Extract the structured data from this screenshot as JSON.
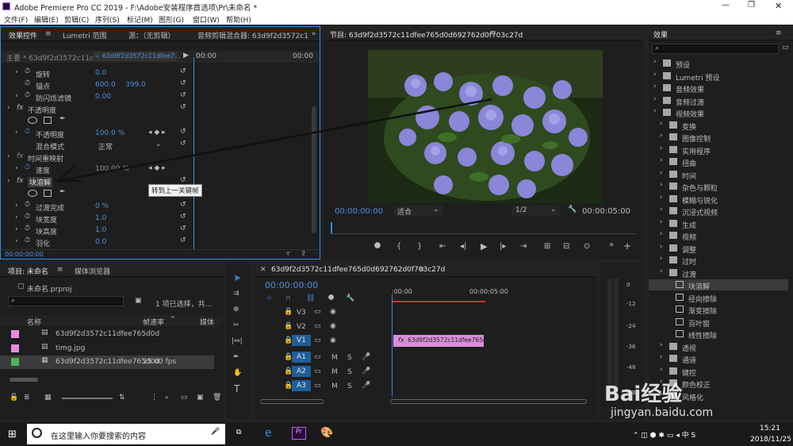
{
  "app": {
    "title": "Adobe Premiere Pro CC 2019 - F:\\Adobe安装程序首选项\\Pr\\未命名 *"
  },
  "menu": [
    "文件(F)",
    "编辑(E)",
    "剪辑(C)",
    "序列(S)",
    "标记(M)",
    "图形(G)",
    "窗口(W)",
    "帮助(H)"
  ],
  "effect_controls": {
    "tabs": [
      "效果控件",
      "Lumetri 范围",
      "源：（无剪辑）",
      "音频剪辑混合器: 63d9f2d3572c1"
    ],
    "master": "主要 * 63d9f2d3572c11df...",
    "clip_sel": "63d9f2d3572c11dfee7...",
    "ruler_start": "00:00",
    "ruler_end": "00:00",
    "rows": [
      {
        "label": "旋转",
        "value": "0.0"
      },
      {
        "label": "锚点",
        "value": "600.0",
        "value2": "399.0"
      },
      {
        "label": "防闪烁滤镜",
        "value": "0.00"
      },
      {
        "label": "不透明度",
        "fx": true
      },
      {
        "label": "不透明度",
        "value": "100.0 %"
      },
      {
        "label": "混合模式",
        "value": "正常"
      },
      {
        "label": "时间重映射",
        "fx": true
      },
      {
        "label": "速度",
        "value": "100.00 %"
      },
      {
        "label": "块溶解",
        "fx": true
      },
      {
        "label": "过渡完成",
        "value": "0 %"
      },
      {
        "label": "块宽度",
        "value": "1.0"
      },
      {
        "label": "块高度",
        "value": "1.0"
      },
      {
        "label": "羽化",
        "value": "0.0"
      }
    ],
    "tooltip": "转到上一关键帧",
    "timecode": "00:00:00:00"
  },
  "program": {
    "title": "节目: 63d9f2d3572c11dfee765d0d692762d0f703c27d",
    "timecode": "00:00:00:00",
    "fit": "适合",
    "ratio": "1/2",
    "duration": "00:00:05:00"
  },
  "effects": {
    "title": "效果",
    "items": [
      {
        "label": "预设",
        "type": "folder",
        "level": 0
      },
      {
        "label": "Lumetri 预设",
        "type": "folder",
        "level": 0
      },
      {
        "label": "音频效果",
        "type": "folder",
        "level": 0
      },
      {
        "label": "音频过渡",
        "type": "folder",
        "level": 0
      },
      {
        "label": "视频效果",
        "type": "folder",
        "level": 0
      },
      {
        "label": "变换",
        "type": "folder",
        "level": 1
      },
      {
        "label": "图像控制",
        "type": "folder",
        "level": 1
      },
      {
        "label": "实用程序",
        "type": "folder",
        "level": 1
      },
      {
        "label": "扭曲",
        "type": "folder",
        "level": 1
      },
      {
        "label": "时间",
        "type": "folder",
        "level": 1
      },
      {
        "label": "杂色与颗粒",
        "type": "folder",
        "level": 1
      },
      {
        "label": "模糊与锐化",
        "type": "folder",
        "level": 1
      },
      {
        "label": "沉浸式视频",
        "type": "folder",
        "level": 1
      },
      {
        "label": "生成",
        "type": "folder",
        "level": 1
      },
      {
        "label": "视频",
        "type": "folder",
        "level": 1
      },
      {
        "label": "调整",
        "type": "folder",
        "level": 1
      },
      {
        "label": "过时",
        "type": "folder",
        "level": 1
      },
      {
        "label": "过渡",
        "type": "folder",
        "level": 1
      },
      {
        "label": "块溶解",
        "type": "effect",
        "level": 2,
        "selected": true
      },
      {
        "label": "径向擦除",
        "type": "effect",
        "level": 2
      },
      {
        "label": "渐变擦除",
        "type": "effect",
        "level": 2
      },
      {
        "label": "百叶窗",
        "type": "effect",
        "level": 2
      },
      {
        "label": "线性擦除",
        "type": "effect",
        "level": 2
      },
      {
        "label": "透视",
        "type": "folder",
        "level": 1
      },
      {
        "label": "通道",
        "type": "folder",
        "level": 1
      },
      {
        "label": "键控",
        "type": "folder",
        "level": 1
      },
      {
        "label": "颜色校正",
        "type": "folder",
        "level": 1
      },
      {
        "label": "风格化",
        "type": "folder",
        "level": 1
      }
    ]
  },
  "project": {
    "tabs": [
      "项目: 未命名",
      "媒体浏览器"
    ],
    "file": "未命名.prproj",
    "selection": "1 项已选择，共...",
    "col_name": "名称",
    "col_fps": "帧速率",
    "col_media": "媒体",
    "items": [
      {
        "name": "63d9f2d3572c11dfee765d0d",
        "fps": "",
        "color": "#e58be0"
      },
      {
        "name": "timg.jpg",
        "fps": "",
        "color": "#e58be0"
      },
      {
        "name": "63d9f2d3572c11dfee765d0d",
        "fps": "25.00 fps",
        "color": "#4db55a",
        "selected": true
      }
    ]
  },
  "timeline": {
    "tab": "63d9f2d3572c11dfee765d0d692762d0f703c27d",
    "timecode": "00:00:00:00",
    "t0": ":00:00",
    "t1": "00:00:05:00",
    "tracks": [
      "V3",
      "V2",
      "V1",
      "A1",
      "A2",
      "A3"
    ],
    "clip": "63d9f2d3572c11dfee765d0d69"
  },
  "meter": {
    "ticks": [
      "0",
      "-12",
      "-24",
      "-36",
      "-48",
      "-dB"
    ]
  },
  "taskbar": {
    "search": "在这里输入你要搜索的内容",
    "time": "15:21",
    "date": "2018/11/25"
  },
  "watermark": {
    "logo": "Bai经验",
    "url": "jingyan.baidu.com"
  }
}
